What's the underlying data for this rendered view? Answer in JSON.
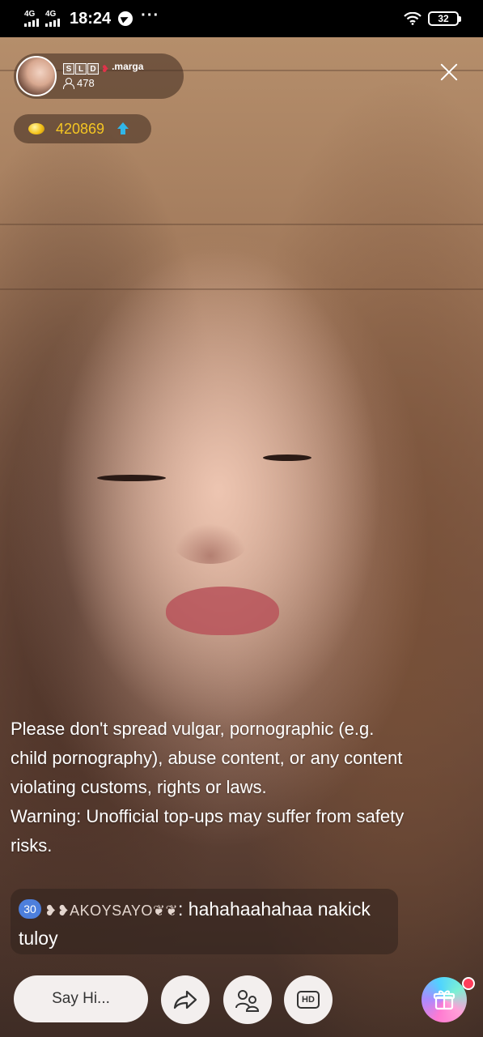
{
  "status_bar": {
    "net1": "4G",
    "net2": "4G",
    "time": "18:24",
    "more": "···",
    "battery": "32"
  },
  "host": {
    "badges": [
      "S",
      "L",
      "D"
    ],
    "name": ".marga",
    "viewers": "478"
  },
  "coins": {
    "value": "420869"
  },
  "notice": {
    "line1": "Please don't spread vulgar, pornographic (e.g. child pornography), abuse content, or any content violating customs, rights or laws.",
    "line2": "Warning: Unofficial top-ups may suffer from safety risks."
  },
  "chat": {
    "level": "30",
    "user": "❥❥AKOYSAYO❦❦",
    "colon": ":",
    "message": " hahahaahahaa nakick tuloy"
  },
  "bottom_bar": {
    "say_hi": "Say Hi...",
    "hd_label": "HD"
  },
  "colors": {
    "coin_text": "#f5c623",
    "level_badge": "#4d7fdc",
    "arrow_up": "#31b6e8",
    "gift_dot": "#ff3d5a"
  },
  "icons": [
    "telegram-icon",
    "wifi-icon",
    "battery-icon",
    "person-icon",
    "heart-icon",
    "close-icon",
    "coin-icon",
    "arrow-up-icon",
    "share-icon",
    "pk-icon",
    "hd-icon",
    "gift-icon"
  ]
}
